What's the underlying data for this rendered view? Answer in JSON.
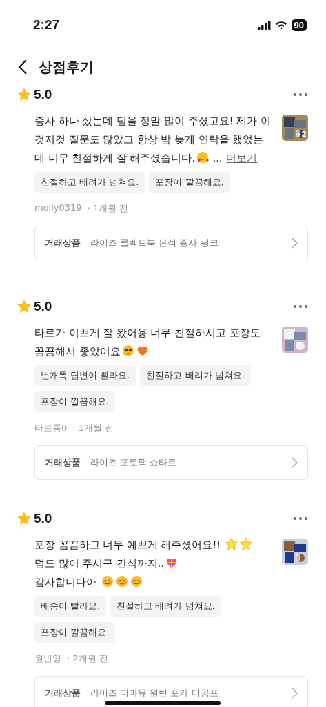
{
  "status_bar": {
    "time": "2:27",
    "battery": "90"
  },
  "header": {
    "title": "상점후기"
  },
  "reviews": [
    {
      "rating": "5.0",
      "lines": [
        [
          {
            "kind": "text",
            "text": "증사 하나 샀는데 덤을 정말 많이 주셨고요! 제가 이"
          }
        ],
        [
          {
            "kind": "text",
            "text": "것저것 질문도 많았고 항상 밤 늦게 연락을 했었는"
          }
        ],
        [
          {
            "kind": "text",
            "text": "데 너무 친절하게 잘 해주셨습니다."
          },
          {
            "kind": "heart-face"
          },
          {
            "kind": "text",
            "text": " ..."
          }
        ]
      ],
      "more": "더보기",
      "photo_count": "+2",
      "tags": [
        "친절하고 배려가 넘쳐요.",
        "포장이 깔끔해요."
      ],
      "author": "molly0319",
      "time": "· 1개월 전",
      "product_label": "거래상품",
      "product": "라이즈 콜렉트북 은석 증사 핑크"
    },
    {
      "rating": "5.0",
      "lines": [
        [
          {
            "kind": "text",
            "text": "타로가 이쁘게 잘 왔어용 너무 친절하시고 포장도"
          }
        ],
        [
          {
            "kind": "text",
            "text": "꼼꼼해서 좋았어요"
          },
          {
            "kind": "pleading-face"
          },
          {
            "kind": "orange-heart"
          }
        ]
      ],
      "tags": [
        "번개톡 답변이 빨라요.",
        "친절하고 배려가 넘쳐요.",
        "포장이 깔끔해요."
      ],
      "author": "타로롱0",
      "time": "· 1개월 전",
      "product_label": "거래상품",
      "product": "라이즈 포토팩 쇼타로"
    },
    {
      "rating": "5.0",
      "lines": [
        [
          {
            "kind": "text",
            "text": "포장 꼼꼼하고 너무 예쁘게 해주셨어요!! "
          },
          {
            "kind": "star"
          },
          {
            "kind": "star"
          }
        ],
        [
          {
            "kind": "text",
            "text": "덤도 많이 주시구 간식까지.."
          },
          {
            "kind": "gift-heart"
          }
        ],
        [
          {
            "kind": "text",
            "text": "감사합니다아 "
          },
          {
            "kind": "blush-face"
          },
          {
            "kind": "blush-face"
          },
          {
            "kind": "blush-face"
          }
        ]
      ],
      "tags": [
        "배송이 빨라요.",
        "친절하고 배려가 넘쳐요.",
        "포장이 깔끔해요."
      ],
      "author": "원빈잉",
      "time": "· 2개월 전",
      "product_label": "거래상품",
      "product": "라이즈 디마뮤 원빈 포카 미공포"
    }
  ]
}
